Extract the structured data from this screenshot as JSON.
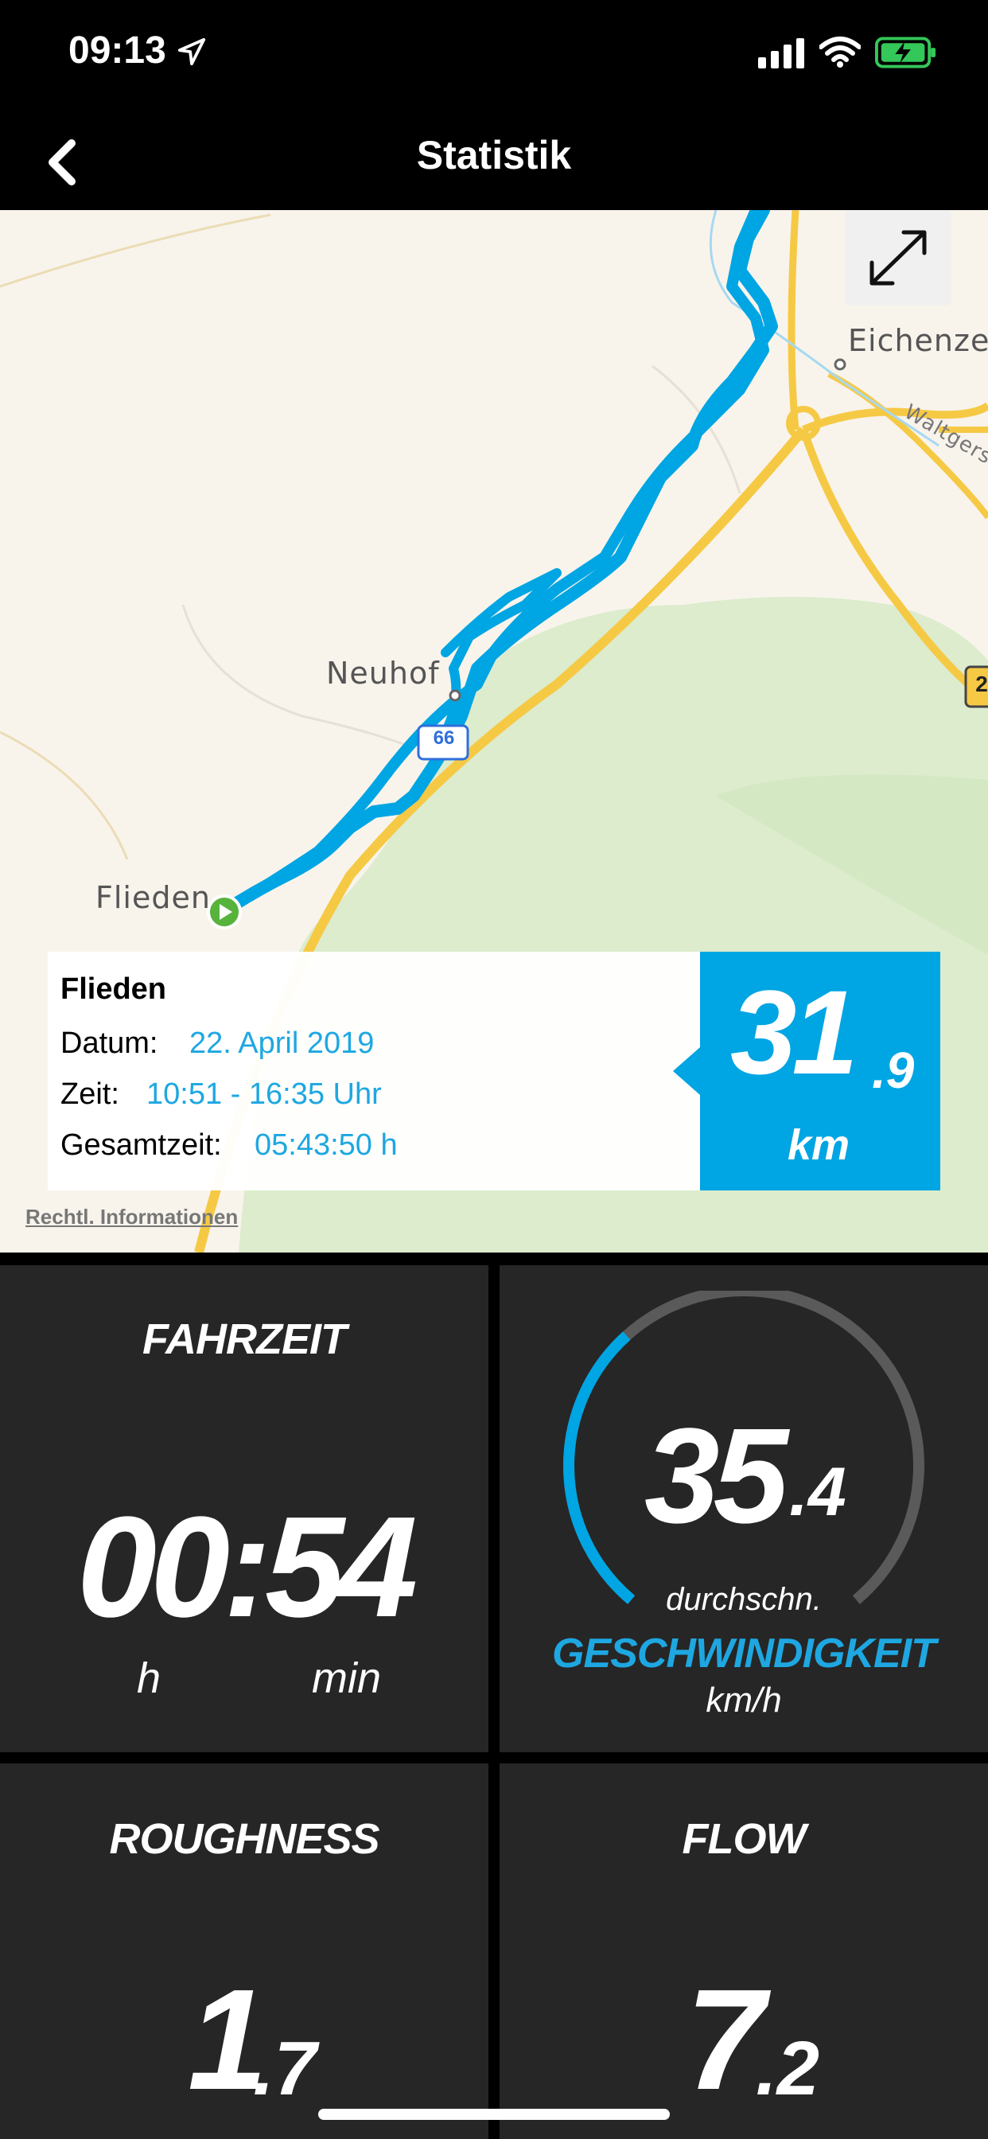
{
  "status_bar": {
    "time": "09:13",
    "icons": [
      "location-arrow-icon",
      "cellular-signal-icon",
      "wifi-icon",
      "battery-charging-icon"
    ],
    "battery_color": "#34c759"
  },
  "nav": {
    "title": "Statistik",
    "back_icon": "chevron-left-icon"
  },
  "map": {
    "labels": {
      "neuhof": "Neuhof",
      "flieden": "Flieden",
      "eichenzell": "Eichenze",
      "waltgerst": "Waltgerst",
      "road_shield": "66",
      "road_shield_2": "2"
    },
    "route_color": "#00a5e3",
    "expand_icon": "expand-arrows-icon",
    "legal_link": "Rechtl. Informationen"
  },
  "ride": {
    "name": "Flieden",
    "datum_label": "Datum:",
    "datum_value": "22. April 2019",
    "zeit_label": "Zeit:",
    "zeit_value": "10:51 - 16:35 Uhr",
    "gesamtzeit_label": "Gesamtzeit:",
    "gesamtzeit_value": "05:43:50 h",
    "distance_int": "31",
    "distance_dec": ".9",
    "distance_unit": "km"
  },
  "tiles": {
    "fahrzeit": {
      "title": "FAHRZEIT",
      "value": "00:54",
      "unit_h": "h",
      "unit_min": "min"
    },
    "speed": {
      "value_int": "35",
      "value_dec": ".4",
      "label": "durchschn.",
      "title": "GESCHWINDIGKEIT",
      "unit": "km/h",
      "gauge_fraction": 0.35,
      "accent": "#00a5e3"
    },
    "roughness": {
      "title": "ROUGHNESS",
      "value_int": "1",
      "value_dec": ".7"
    },
    "flow": {
      "title": "FLOW",
      "value_int": "7",
      "value_dec": ".2"
    }
  }
}
